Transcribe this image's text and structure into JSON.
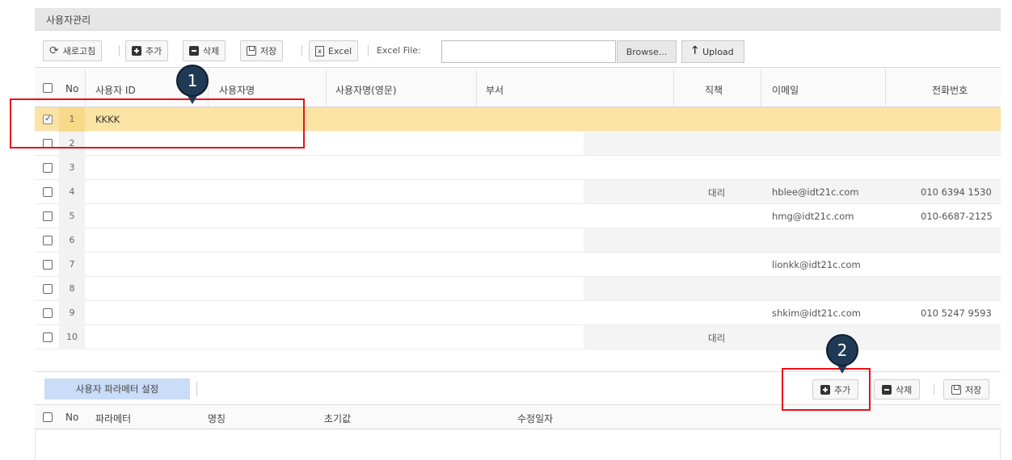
{
  "panel": {
    "title": "사용자관리"
  },
  "toolbar": {
    "refresh": "새로고침",
    "add": "추가",
    "delete": "삭제",
    "save": "저장",
    "excel": "Excel",
    "excel_file_label": "Excel File:",
    "file_value": "",
    "browse": "Browse...",
    "upload": "Upload"
  },
  "grid": {
    "headers": {
      "no": "No",
      "user_id": "사용자 ID",
      "user_name": "사용자명",
      "user_name_en": "사용자명(영문)",
      "department": "부서",
      "position": "직책",
      "email": "이메일",
      "phone": "전화번호"
    },
    "rows": [
      {
        "no": "1",
        "user_id": "KKKK",
        "position": "",
        "email": "",
        "phone": "",
        "checked": true
      },
      {
        "no": "2",
        "user_id": "",
        "position": "",
        "email": "",
        "phone": ""
      },
      {
        "no": "3",
        "user_id": "",
        "position": "",
        "email": "",
        "phone": ""
      },
      {
        "no": "4",
        "user_id": "",
        "position": "대리",
        "email": "hblee@idt21c.com",
        "phone": "010 6394 1530"
      },
      {
        "no": "5",
        "user_id": "",
        "position": "",
        "email": "hmg@idt21c.com",
        "phone": "010-6687-2125"
      },
      {
        "no": "6",
        "user_id": "",
        "position": "",
        "email": "",
        "phone": ""
      },
      {
        "no": "7",
        "user_id": "",
        "position": "",
        "email": "lionkk@idt21c.com",
        "phone": ""
      },
      {
        "no": "8",
        "user_id": "",
        "position": "",
        "email": "",
        "phone": ""
      },
      {
        "no": "9",
        "user_id": "",
        "position": "",
        "email": "shkim@idt21c.com",
        "phone": "010 5247 9593"
      },
      {
        "no": "10",
        "user_id": "",
        "position": "대리",
        "email": "",
        "phone": ""
      }
    ]
  },
  "sub": {
    "tab": "사용자 파라메터 설정",
    "add": "추가",
    "delete": "삭제",
    "save": "저장",
    "headers": {
      "no": "No",
      "param": "파라메터",
      "name": "명칭",
      "initial": "초기값",
      "modified": "수정일자"
    }
  },
  "annotations": {
    "one": "1",
    "two": "2"
  },
  "colors": {
    "annotation_red": "#e8101a",
    "bubble": "#1f3a55",
    "selected_row": "#fbe3a4",
    "sub_tab": "#c9dcf8"
  }
}
